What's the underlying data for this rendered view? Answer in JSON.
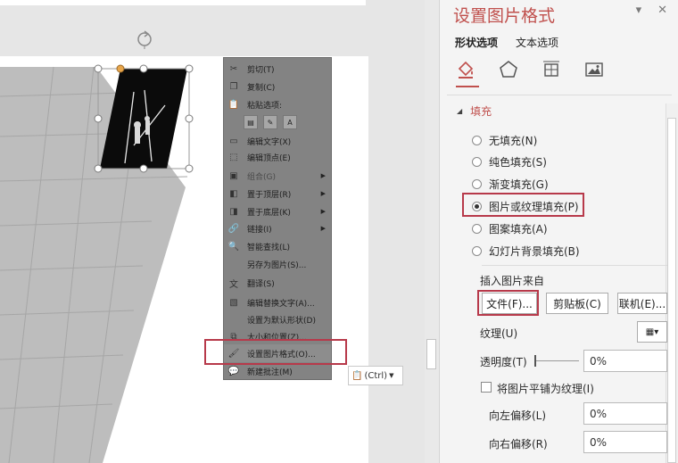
{
  "panel": {
    "title": "设置图片格式",
    "tabs": [
      "形状选项",
      "文本选项"
    ],
    "active_tab": "形状选项",
    "section": "填充",
    "icons": [
      "fill-line-icon",
      "effects-icon",
      "size-properties-icon",
      "picture-icon"
    ],
    "fill_options": [
      {
        "label": "无填充(N)",
        "selected": false
      },
      {
        "label": "纯色填充(S)",
        "selected": false
      },
      {
        "label": "渐变填充(G)",
        "selected": false
      },
      {
        "label": "图片或纹理填充(P)",
        "selected": true
      },
      {
        "label": "图案填充(A)",
        "selected": false
      },
      {
        "label": "幻灯片背景填充(B)",
        "selected": false
      }
    ],
    "insert_from": "插入图片来自",
    "buttons": {
      "file": "文件(F)...",
      "clipboard": "剪贴板(C)",
      "online": "联机(E)..."
    },
    "texture_label": "纹理(U)",
    "transparency_label": "透明度(T)",
    "transparency_value": "0%",
    "tile_label": "将图片平铺为纹理(I)",
    "offset_left_label": "向左偏移(L)",
    "offset_left_value": "0%",
    "offset_right_label": "向右偏移(R)",
    "offset_right_value": "0%"
  },
  "context_menu": {
    "paste_options_label": "粘贴选项:",
    "items": [
      {
        "label": "剪切(T)",
        "icon": "scissors-icon",
        "disabled": false,
        "submenu": false
      },
      {
        "label": "复制(C)",
        "icon": "copy-icon",
        "disabled": false,
        "submenu": false
      },
      {
        "label": "编辑文字(X)",
        "icon": "edit-text-icon",
        "disabled": false,
        "submenu": false
      },
      {
        "label": "编辑顶点(E)",
        "icon": "edit-points-icon",
        "disabled": false,
        "submenu": false
      },
      {
        "label": "组合(G)",
        "icon": "group-icon",
        "disabled": true,
        "submenu": true
      },
      {
        "label": "置于顶层(R)",
        "icon": "bring-front-icon",
        "disabled": false,
        "submenu": true
      },
      {
        "label": "置于底层(K)",
        "icon": "send-back-icon",
        "disabled": false,
        "submenu": true
      },
      {
        "label": "链接(I)",
        "icon": "link-icon",
        "disabled": false,
        "submenu": true
      },
      {
        "label": "智能查找(L)",
        "icon": "smart-lookup-icon",
        "disabled": false,
        "submenu": false
      },
      {
        "label": "另存为图片(S)...",
        "icon": "",
        "disabled": false,
        "submenu": false
      },
      {
        "label": "翻译(S)",
        "icon": "translate-icon",
        "disabled": false,
        "submenu": false
      },
      {
        "label": "编辑替换文字(A)...",
        "icon": "alt-text-icon",
        "disabled": false,
        "submenu": false
      },
      {
        "label": "设置为默认形状(D)",
        "icon": "",
        "disabled": false,
        "submenu": false
      },
      {
        "label": "大小和位置(Z)...",
        "icon": "size-icon",
        "disabled": false,
        "submenu": false
      },
      {
        "label": "设置图片格式(O)...",
        "icon": "format-picture-icon",
        "disabled": false,
        "submenu": false
      },
      {
        "label": "新建批注(M)",
        "icon": "new-comment-icon",
        "disabled": false,
        "submenu": false
      }
    ]
  },
  "paste_tag": {
    "label": "(Ctrl)"
  },
  "colors": {
    "accent": "#c0504d",
    "highlight_box": "#b7394a"
  }
}
